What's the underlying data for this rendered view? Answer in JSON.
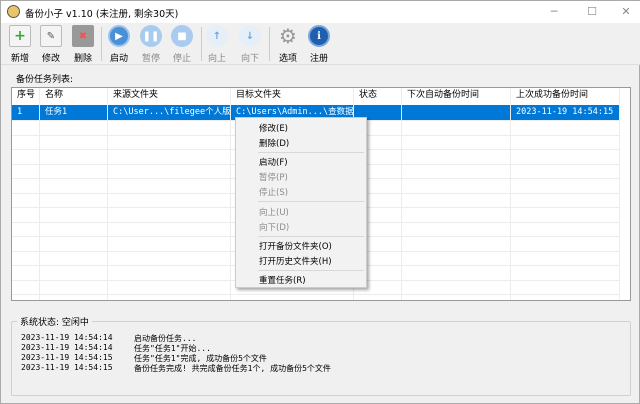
{
  "window": {
    "title": "备份小子 v1.10  (未注册, 剩余30天)",
    "minimize": "─",
    "maximize": "☐",
    "close": "✕"
  },
  "toolbar": [
    {
      "label": "新增",
      "icon": "add-icon",
      "enabled": true
    },
    {
      "label": "修改",
      "icon": "edit-icon",
      "enabled": true
    },
    {
      "label": "删除",
      "icon": "delete-icon",
      "enabled": true
    },
    {
      "label": "启动",
      "icon": "play-icon",
      "enabled": true
    },
    {
      "label": "暂停",
      "icon": "pause-icon",
      "enabled": false
    },
    {
      "label": "停止",
      "icon": "stop-icon",
      "enabled": false
    },
    {
      "label": "向上",
      "icon": "arrow-up-icon",
      "enabled": false
    },
    {
      "label": "向下",
      "icon": "arrow-down-icon",
      "enabled": false
    },
    {
      "label": "选项",
      "icon": "gear-icon",
      "enabled": true
    },
    {
      "label": "注册",
      "icon": "info-icon",
      "enabled": true
    }
  ],
  "list_label": "备份任务列表:",
  "table": {
    "columns": [
      "序号",
      "名称",
      "来源文件夹",
      "目标文件夹",
      "状态",
      "下次自动备份时间",
      "上次成功备份时间"
    ],
    "rows": [
      [
        "1",
        "任务1",
        "C:\\User...\\filegee个人版",
        "C:\\Users\\Admin...\\查数据",
        "",
        "",
        "2023-11-19 14:54:15"
      ]
    ]
  },
  "context_menu": {
    "items": [
      {
        "label": "修改(E)",
        "enabled": true
      },
      {
        "label": "删除(D)",
        "enabled": true
      },
      {
        "label": "启动(F)",
        "enabled": true
      },
      {
        "label": "暂停(P)",
        "enabled": false
      },
      {
        "label": "停止(S)",
        "enabled": false
      },
      {
        "label": "向上(U)",
        "enabled": false
      },
      {
        "label": "向下(D)",
        "enabled": false
      },
      {
        "label": "打开备份文件夹(O)",
        "enabled": true
      },
      {
        "label": "打开历史文件夹(H)",
        "enabled": true
      },
      {
        "label": "重置任务(R)",
        "enabled": true
      }
    ]
  },
  "status": {
    "legend": "系统状态: 空闲中",
    "log": [
      {
        "time": "2023-11-19 14:54:14",
        "message": "启动备份任务..."
      },
      {
        "time": "2023-11-19 14:54:14",
        "message": "任务\"任务1\"开始..."
      },
      {
        "time": "2023-11-19 14:54:15",
        "message": "任务\"任务1\"完成, 成功备份5个文件"
      },
      {
        "time": "2023-11-19 14:54:15",
        "message": "备份任务完成! 共完成备份任务1个, 成功备份5个文件"
      }
    ]
  },
  "colors": {
    "selection": "#0078d7",
    "accent_blue": "#2a78c8"
  }
}
